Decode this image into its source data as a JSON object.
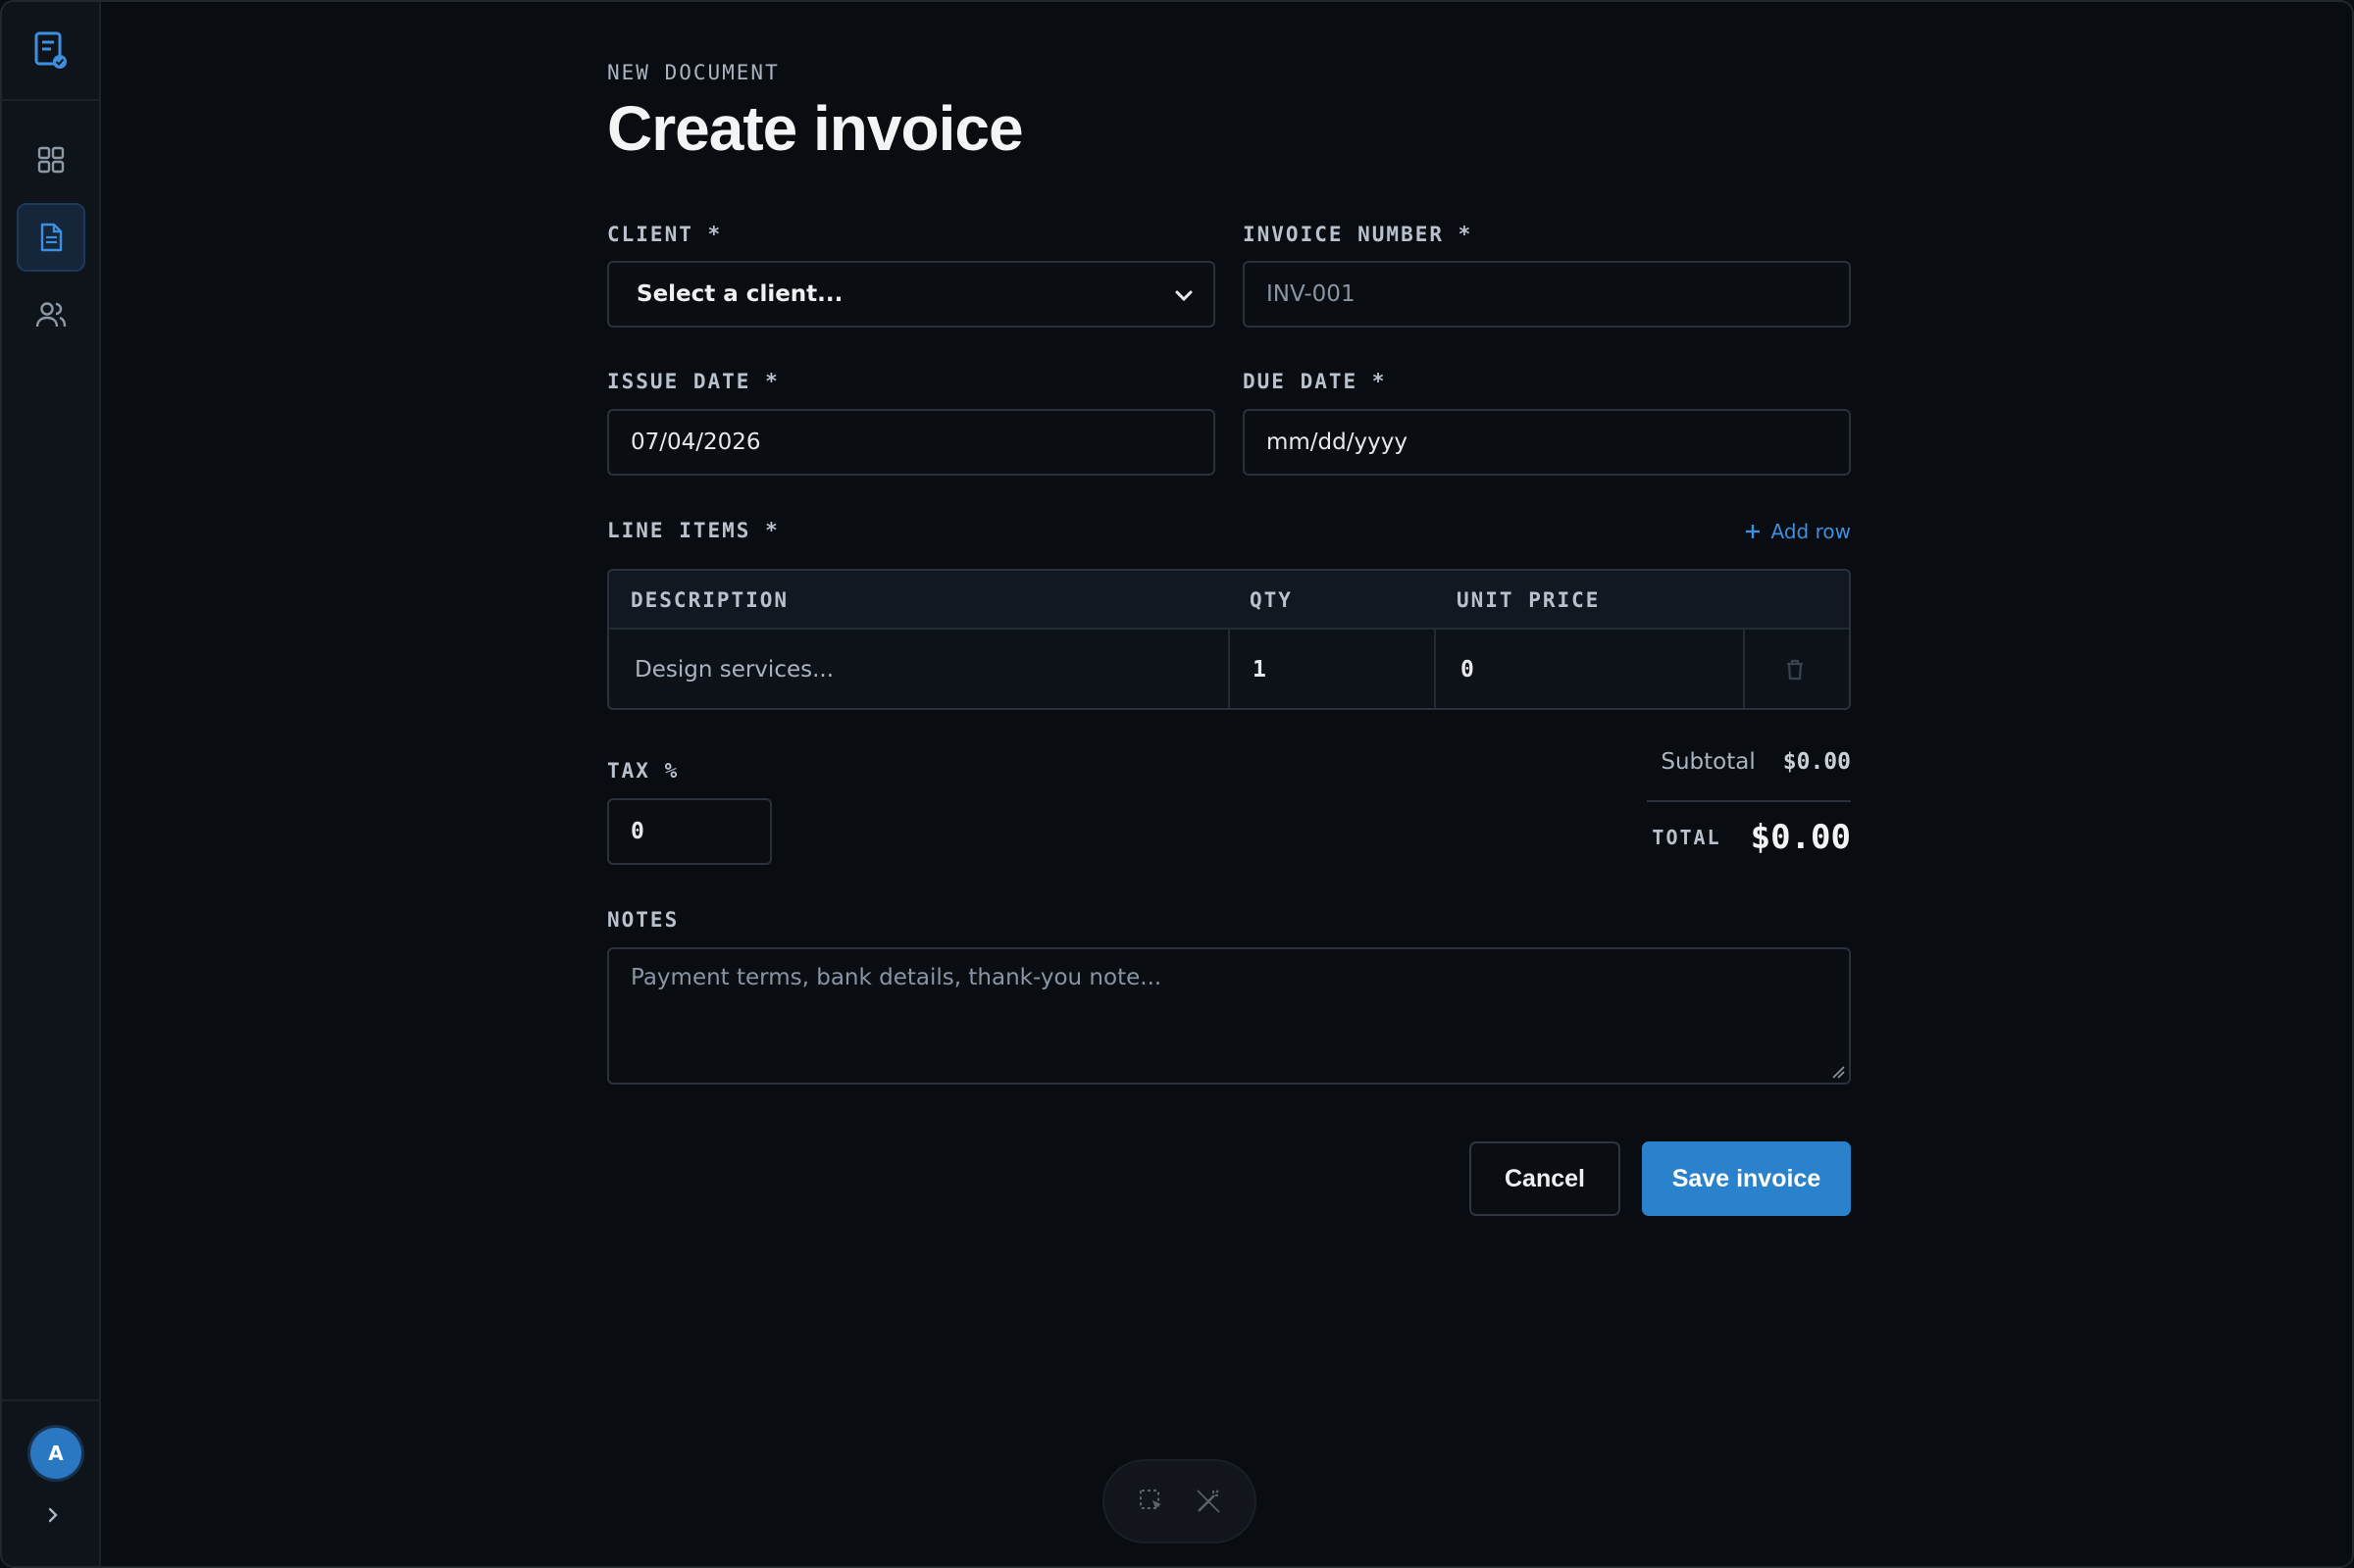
{
  "header": {
    "kicker": "NEW DOCUMENT",
    "title": "Create invoice"
  },
  "form": {
    "client": {
      "label": "CLIENT *",
      "value": "Select a client..."
    },
    "invoice_number": {
      "label": "INVOICE NUMBER *",
      "placeholder": "INV-001"
    },
    "issue_date": {
      "label": "ISSUE DATE *",
      "value": "07/04/2026"
    },
    "due_date": {
      "label": "DUE DATE *",
      "value": "mm/dd/yyyy"
    },
    "line_items": {
      "label": "LINE ITEMS *",
      "add_row": "Add row",
      "columns": [
        "DESCRIPTION",
        "QTY",
        "UNIT PRICE"
      ],
      "rows": [
        {
          "description": "Design services...",
          "qty": "1",
          "unit_price": "0"
        }
      ]
    },
    "tax": {
      "label": "TAX %",
      "value": "0"
    },
    "notes": {
      "label": "NOTES",
      "placeholder": "Payment terms, bank details, thank-you note..."
    }
  },
  "totals": {
    "subtotal_label": "Subtotal",
    "subtotal_value": "$0.00",
    "total_label": "TOTAL",
    "total_value": "$0.00"
  },
  "actions": {
    "cancel": "Cancel",
    "save": "Save invoice"
  },
  "sidebar": {
    "items": [
      {
        "icon": "dashboard-icon"
      },
      {
        "icon": "document-icon",
        "active": true
      },
      {
        "icon": "users-icon"
      }
    ],
    "avatar": "A"
  },
  "colors": {
    "accent": "#2b82cc",
    "background": "#090c10",
    "link": "#3d8fe0"
  }
}
